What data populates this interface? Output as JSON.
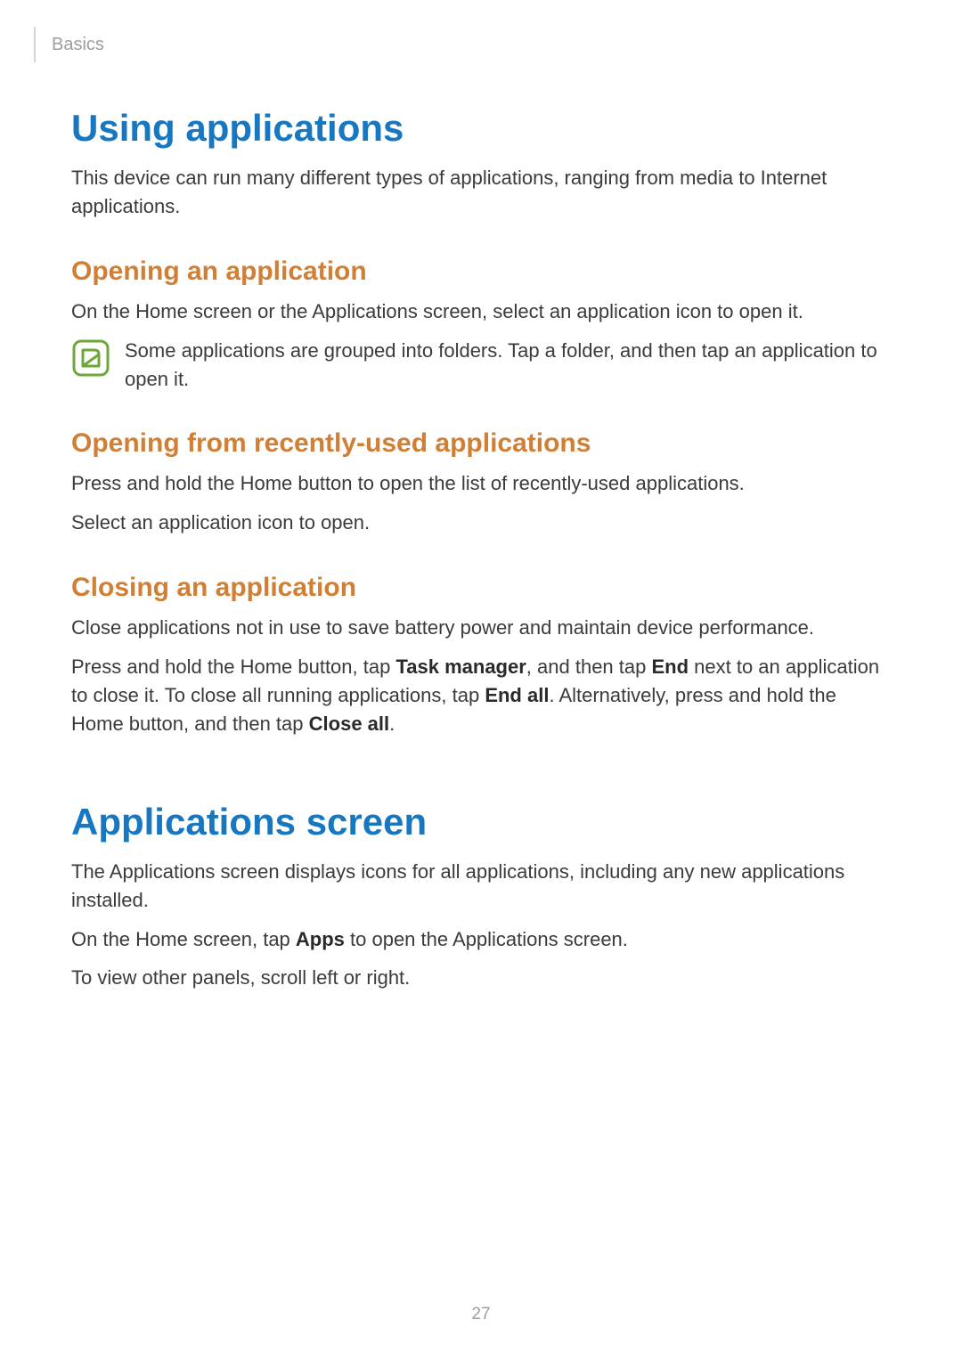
{
  "header": {
    "chapter": "Basics"
  },
  "page_number": "27",
  "section1": {
    "title": "Using applications",
    "intro": "This device can run many different types of applications, ranging from media to Internet applications.",
    "sub1": {
      "title": "Opening an application",
      "p1": "On the Home screen or the Applications screen, select an application icon to open it.",
      "note": "Some applications are grouped into folders. Tap a folder, and then tap an application to open it."
    },
    "sub2": {
      "title": "Opening from recently-used applications",
      "p1": "Press and hold the Home button to open the list of recently-used applications.",
      "p2": "Select an application icon to open."
    },
    "sub3": {
      "title": "Closing an application",
      "p1": "Close applications not in use to save battery power and maintain device performance.",
      "p2_parts": {
        "t1": "Press and hold the Home button, tap ",
        "b1": "Task manager",
        "t2": ", and then tap ",
        "b2": "End",
        "t3": " next to an application to close it. To close all running applications, tap ",
        "b3": "End all",
        "t4": ". Alternatively, press and hold the Home button, and then tap ",
        "b4": "Close all",
        "t5": "."
      }
    }
  },
  "section2": {
    "title": "Applications screen",
    "p1": "The Applications screen displays icons for all applications, including any new applications installed.",
    "p2_parts": {
      "t1": "On the Home screen, tap ",
      "b1": "Apps",
      "t2": " to open the Applications screen."
    },
    "p3": "To view other panels, scroll left or right."
  },
  "icons": {
    "note_icon": "note-icon"
  }
}
